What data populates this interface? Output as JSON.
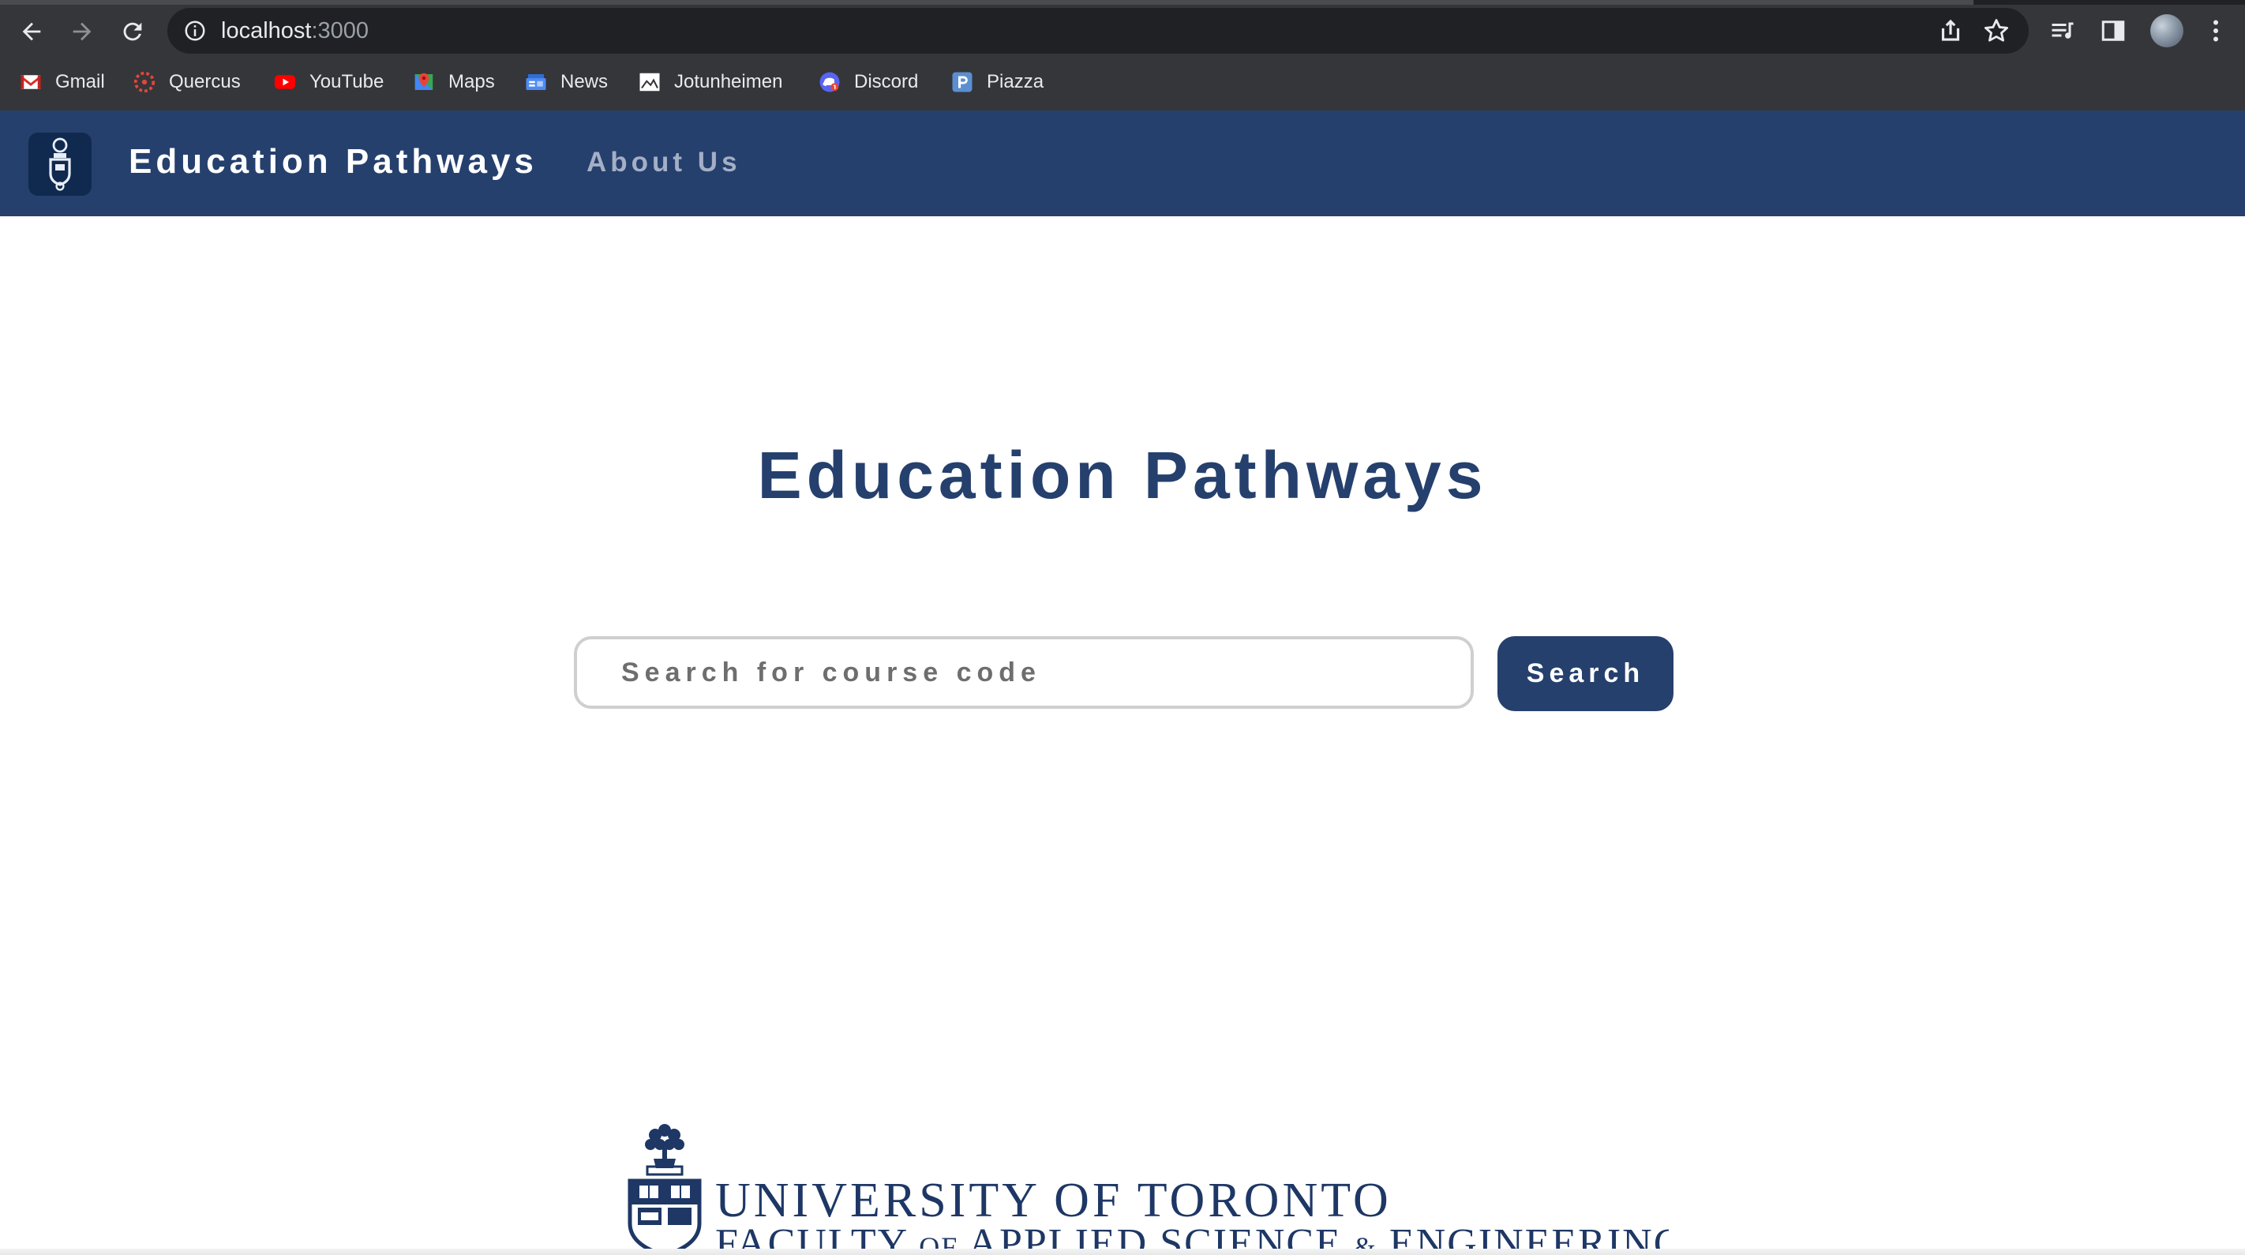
{
  "browser": {
    "url_host": "localhost",
    "url_port": ":3000",
    "bookmarks": [
      {
        "label": "Gmail",
        "icon": "gmail-icon"
      },
      {
        "label": "Quercus",
        "icon": "quercus-icon"
      },
      {
        "label": "YouTube",
        "icon": "youtube-icon"
      },
      {
        "label": "Maps",
        "icon": "maps-icon"
      },
      {
        "label": "News",
        "icon": "news-icon"
      },
      {
        "label": "Jotunheimen",
        "icon": "jotunheimen-icon"
      },
      {
        "label": "Discord",
        "icon": "discord-icon"
      },
      {
        "label": "Piazza",
        "icon": "piazza-icon"
      }
    ]
  },
  "header": {
    "site_name": "Education Pathways",
    "nav_about": "About Us"
  },
  "main": {
    "title": "Education Pathways",
    "search_placeholder": "Search for course code",
    "search_button": "Search"
  },
  "footer": {
    "logo_line1": "UNIVERSITY OF TORONTO",
    "logo_line2_a": "FACULTY",
    "logo_line2_b": "OF",
    "logo_line2_c": "APPLIED SCIENCE",
    "logo_line2_d": "&",
    "logo_line2_e": "ENGINEERING"
  },
  "colors": {
    "brand_navy": "#25406d",
    "chrome_dark": "#35363a",
    "omnibox": "#202124"
  }
}
